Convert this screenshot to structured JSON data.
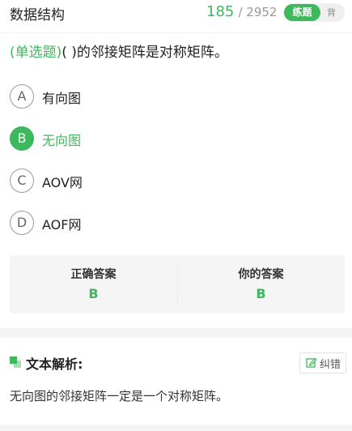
{
  "header": {
    "title": "数据结构",
    "progress_current": "185",
    "progress_total": "/ 2952",
    "mode_active": "练题",
    "mode_inactive": "背"
  },
  "question": {
    "type_label": "(单选题)",
    "text": "(       )的邻接矩阵是对称矩阵。"
  },
  "options": [
    {
      "letter": "A",
      "text": "有向图",
      "selected": false
    },
    {
      "letter": "B",
      "text": "无向图",
      "selected": true
    },
    {
      "letter": "C",
      "text": "AOV网",
      "selected": false
    },
    {
      "letter": "D",
      "text": "AOF网",
      "selected": false
    }
  ],
  "answers": {
    "correct_label": "正确答案",
    "correct_value": "B",
    "yours_label": "你的答案",
    "yours_value": "B"
  },
  "analysis": {
    "heading": "文本解析:",
    "correct_button": "纠错",
    "text": "无向图的邻接矩阵一定是一个对称矩阵。"
  },
  "colors": {
    "accent": "#3db85c",
    "muted": "#9a9a9a"
  }
}
